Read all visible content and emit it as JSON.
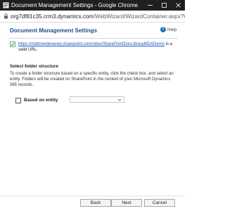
{
  "window": {
    "title": "Document Management Settings - Google Chrome",
    "minimize_label": "—",
    "maximize_label": "□",
    "close_label": "✕"
  },
  "address": {
    "host": "org7df81c35.crm3.dynamics.com",
    "path": "/WebWizard/WizardContainer.aspx?Wiza..."
  },
  "dialog": {
    "heading": "Document Management Settings",
    "help_label": "Help",
    "valid_url_link": "https://mattrewdevaney.sharepoint.com/sites/SharePointDocLibraryMDADemo",
    "valid_url_suffix": " is a valid URL.",
    "section_title": "Select folder structure",
    "description": "To create a folder structure based on a specific entity, click the check box, and select an entity. Folders will be created on SharePoint in the context of your Microsoft Dynamics 365 records.",
    "based_on_entity_label": "Based on entity",
    "entity_select_value": ""
  },
  "footer": {
    "back_label": "Back",
    "next_label": "Next",
    "cancel_label": "Cancel"
  },
  "icons": {
    "app": "chrome-page-icon",
    "lock": "lock-icon",
    "valid": "check-icon",
    "help": "help-icon",
    "dropdown": "chevron-down-icon"
  },
  "colors": {
    "titlebar": "#1f1f1f",
    "heading": "#1e4e8c",
    "link": "#1a56c4",
    "valid": "#2e8b3d"
  }
}
